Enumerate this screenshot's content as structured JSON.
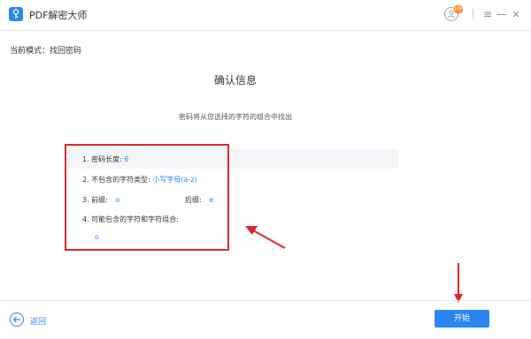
{
  "app": {
    "title": "PDF解密大师"
  },
  "titlebar": {
    "vip_badge": "VIP",
    "menu_icon": "≡",
    "minimize_icon": "—",
    "close_icon": "×"
  },
  "mode": {
    "label": "当前模式：找回密码"
  },
  "page": {
    "title": "确认信息",
    "subtitle": "密码将从您选择的字符的组合中找出"
  },
  "info": {
    "length_label": "1. 密码长度:",
    "length_value": "6",
    "exclude_label": "2. 不包含的字符类型:",
    "exclude_value": "小写字母(a-z)",
    "prefix_label": "3. 前缀:",
    "prefix_value": "o",
    "suffix_label": "后缀:",
    "suffix_value": "e",
    "include_label": "4. 可能包含的字符和字符组合:",
    "include_value": "o"
  },
  "footer": {
    "back_label": "返回",
    "start_label": "开始"
  },
  "colors": {
    "accent": "#2a86f2",
    "annotation": "#e0262c",
    "band": "#f3f5f8"
  },
  "icons": [
    "key-icon",
    "user-icon",
    "menu-icon",
    "minimize-icon",
    "close-icon",
    "back-arrow-icon"
  ]
}
